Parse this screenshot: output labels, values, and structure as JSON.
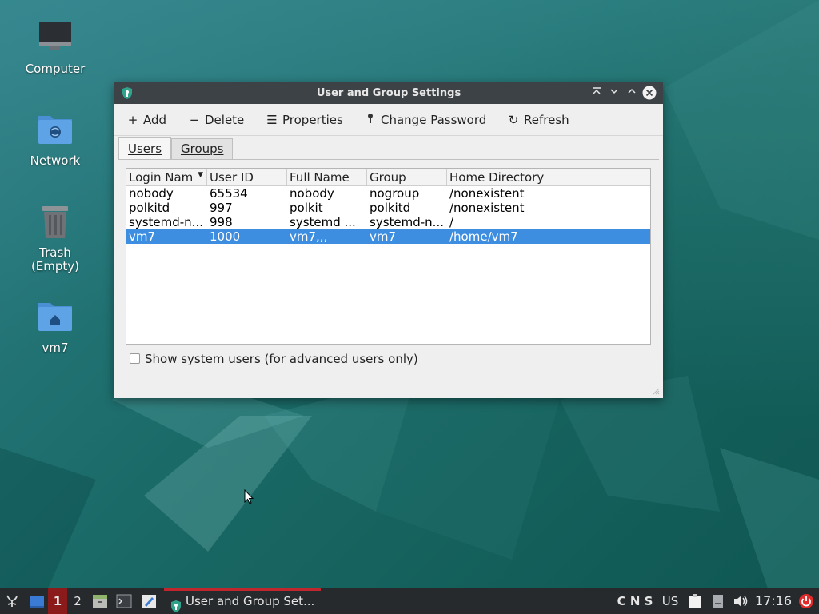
{
  "desktop": {
    "icons": [
      {
        "label": "Computer"
      },
      {
        "label": "Network"
      },
      {
        "label": "Trash"
      },
      {
        "label": "(Empty)"
      },
      {
        "label": "vm7"
      }
    ]
  },
  "window": {
    "title": "User and Group Settings",
    "toolbar": {
      "add": "Add",
      "delete": "Delete",
      "properties": "Properties",
      "change_password": "Change Password",
      "refresh": "Refresh"
    },
    "tabs": [
      {
        "label": "Users",
        "active": true
      },
      {
        "label": "Groups",
        "active": false
      }
    ],
    "table": {
      "columns": [
        "Login Nam",
        "User ID",
        "Full Name",
        "Group",
        "Home Directory"
      ],
      "rows": [
        {
          "login": "nobody",
          "uid": "65534",
          "full_name": "nobody",
          "group": "nogroup",
          "home": "/nonexistent",
          "selected": false
        },
        {
          "login": "polkitd",
          "uid": "997",
          "full_name": "polkit",
          "group": "polkitd",
          "home": "/nonexistent",
          "selected": false
        },
        {
          "login": "systemd-n...",
          "uid": "998",
          "full_name": "systemd ...",
          "group": "systemd-n...",
          "home": "/",
          "selected": false
        },
        {
          "login": "vm7",
          "uid": "1000",
          "full_name": "vm7,,,",
          "group": "vm7",
          "home": "/home/vm7",
          "selected": true
        }
      ]
    },
    "show_system_users": {
      "label": "Show system users (for advanced users only)",
      "checked": false
    }
  },
  "taskbar": {
    "workspaces": [
      "1",
      "2"
    ],
    "active_workspace": "1",
    "task_label": "User and Group Set...",
    "indicators": "C N S",
    "keyboard_layout": "US",
    "clock": "17:16"
  },
  "colors": {
    "selection": "#3d8ee0",
    "titlebar": "#3d4246",
    "taskbar": "#262a2d",
    "workspace_active": "#8b1a1a",
    "task_underline": "#c0262d",
    "power": "#e02a2a"
  }
}
